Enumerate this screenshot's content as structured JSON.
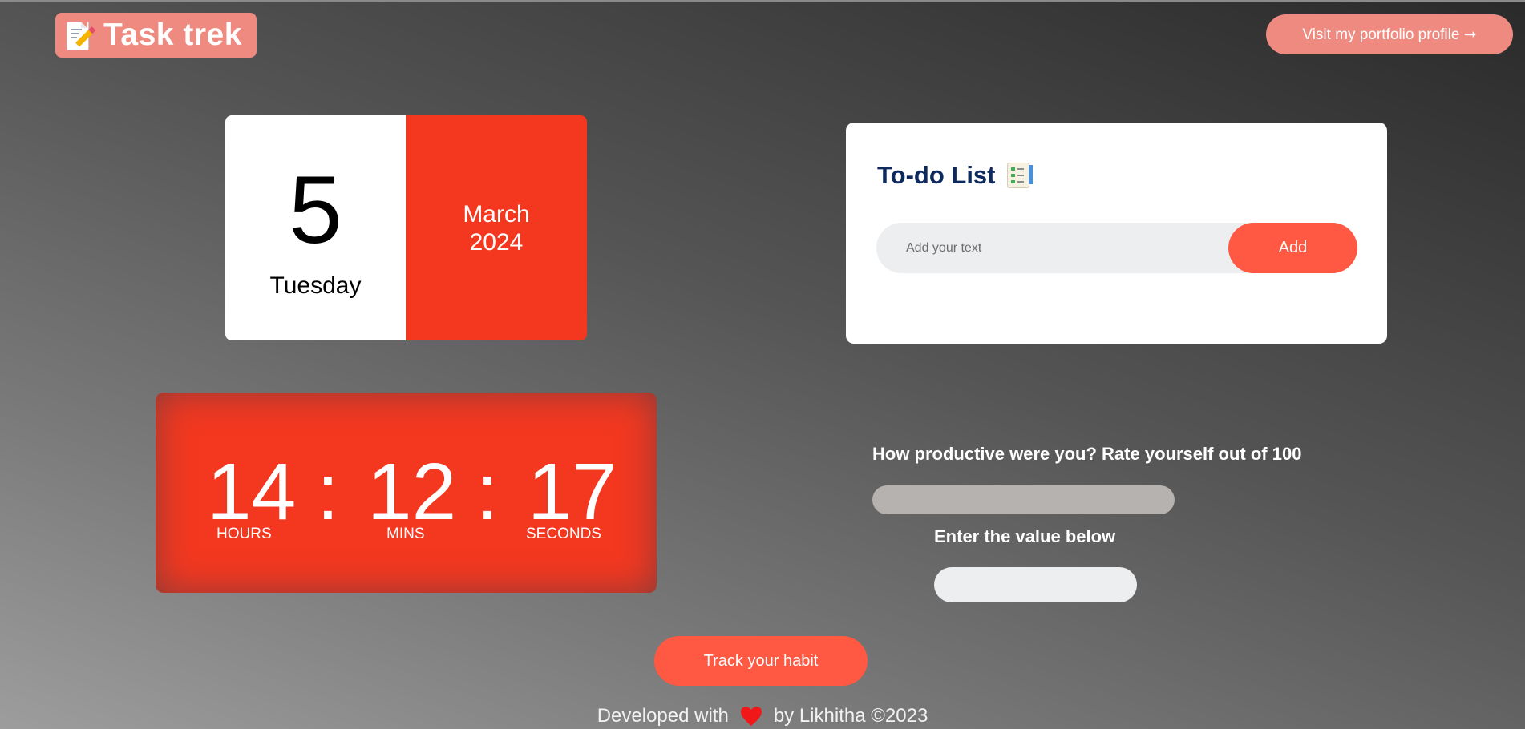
{
  "header": {
    "logo_text": "Task trek",
    "logo_icon": "memo-icon",
    "portfolio_label": "Visit my portfolio profile ➞"
  },
  "date_card": {
    "day_number": "5",
    "weekday": "Tuesday",
    "month": "March",
    "year": "2024"
  },
  "todo": {
    "title": "To-do List",
    "title_icon": "checklist-icon",
    "input_placeholder": "Add your text",
    "input_value": "",
    "add_label": "Add"
  },
  "clock": {
    "hours": "14",
    "minutes": "12",
    "seconds": "17",
    "separator": ":",
    "hours_label": "HOURS",
    "minutes_label": "MINS",
    "seconds_label": "SECONDS"
  },
  "productivity": {
    "question": "How productive were you? Rate yourself out of 100",
    "enter_label": "Enter the value below",
    "progress_percent": 0,
    "input_value": ""
  },
  "track_label": "Track your habit",
  "footer": {
    "prefix": "Developed with",
    "suffix": "by Likhitha ©2023",
    "heart_icon": "heart-icon"
  },
  "colors": {
    "accent": "#ff5843",
    "date_red": "#f43820",
    "logo_bg": "#ee8a80",
    "title_blue": "#0e2a5c"
  }
}
